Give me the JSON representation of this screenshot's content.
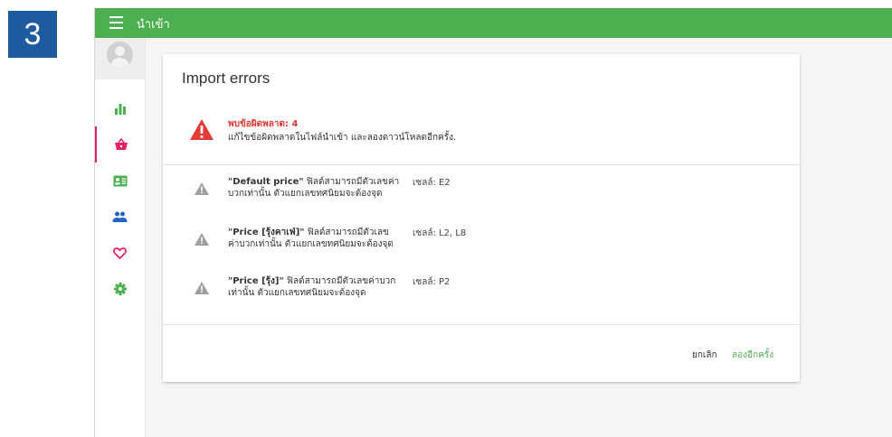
{
  "step": {
    "number": "3"
  },
  "topbar": {
    "title": "นำเข้า"
  },
  "sidebar": {
    "items": [
      {
        "icon": "bar-chart-icon",
        "color": "#4caf50"
      },
      {
        "icon": "basket-icon",
        "color": "#e91e63",
        "active": true
      },
      {
        "icon": "contact-card-icon",
        "color": "#4caf50"
      },
      {
        "icon": "people-icon",
        "color": "#1e63c6"
      },
      {
        "icon": "heart-icon",
        "color": "#e91e63"
      },
      {
        "icon": "gear-icon",
        "color": "#4caf50"
      }
    ]
  },
  "dialog": {
    "title": "Import errors",
    "summary": {
      "count_text": "พบข้อผิดพลาด: 4",
      "help_text": "แก้ไขข้อผิดพลาดในไฟล์นำเข้า และลองดาวน์โหลดอีกครั้ง."
    },
    "errors": [
      {
        "field": "\"Default price\"",
        "message": "ฟิลด์สามารถมีตัวเลขค่าบวกเท่านั้น ตัวแยกเลขทศนิยมจะต้องจุด",
        "cell": "เซลล์: E2"
      },
      {
        "field": "\"Price [รุ้งคาเฟ่]\"",
        "message": "ฟิลด์สามารถมีตัวเลขค่าบวกเท่านั้น ตัวแยกเลขทศนิยมจะต้องจุด",
        "cell": "เซลล์: L2, L8"
      },
      {
        "field": "\"Price [รุ้ง]\"",
        "message": "ฟิลด์สามารถมีตัวเลขค่าบวกเท่านั้น ตัวแยกเลขทศนิยมจะต้องจุด",
        "cell": "เซลล์: P2"
      }
    ],
    "buttons": {
      "cancel": "ยกเลิก",
      "retry": "ลองอีกครั้ง"
    }
  },
  "colors": {
    "topbar": "#4caf50",
    "step_badge": "#1c5b9f",
    "error_red": "#e53935",
    "warning_grey": "#9e9e9e",
    "accent_green": "#4caf50"
  }
}
